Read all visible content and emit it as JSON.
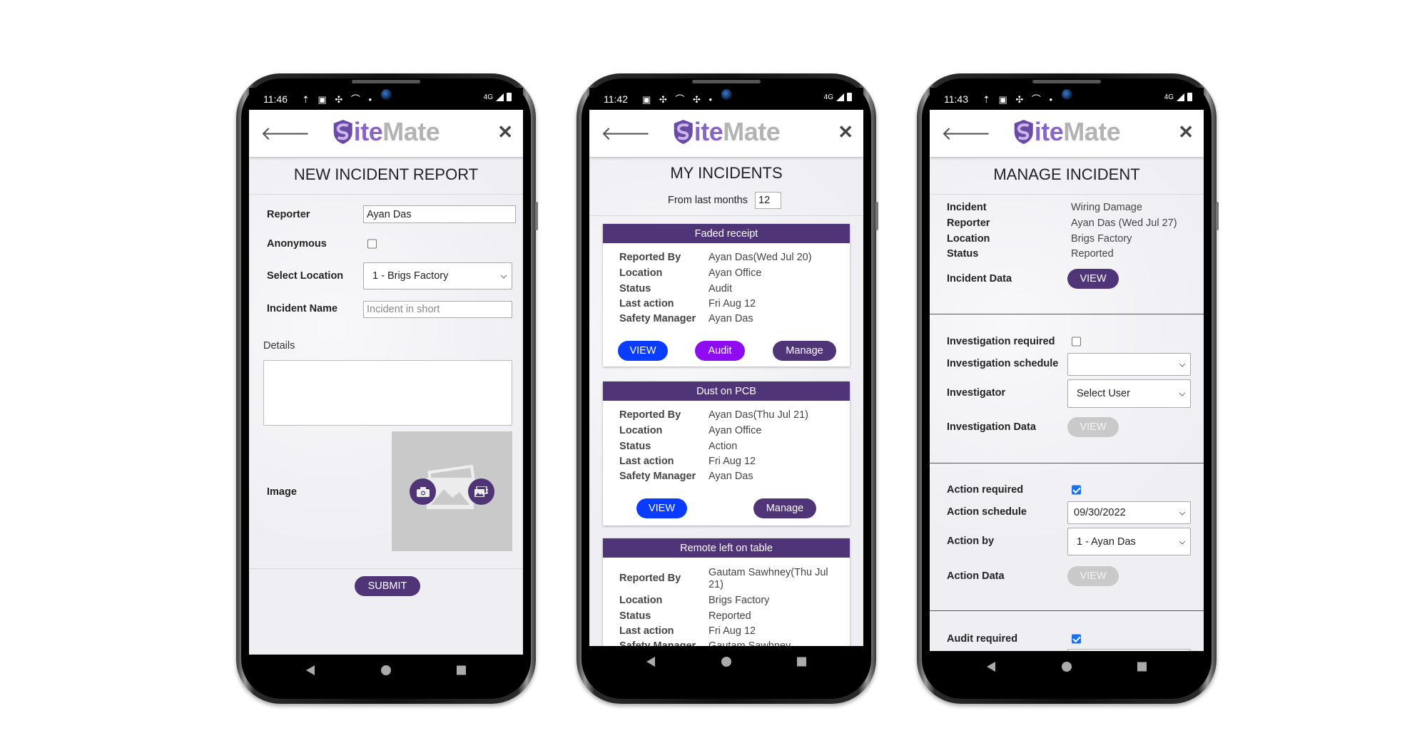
{
  "logo": {
    "a": "ite",
    "b": "Mate"
  },
  "colors": {
    "brand_purple": "#4f3478",
    "view_blue": "#0a3cff",
    "audit_violet": "#8f0cf0",
    "disabled": "#c9c9c9"
  },
  "phone1": {
    "status": {
      "time": "11:46",
      "network": "4G"
    },
    "title": "NEW INCIDENT REPORT",
    "reporter_label": "Reporter",
    "reporter_value": "Ayan Das",
    "anonymous_label": "Anonymous",
    "anonymous_checked": false,
    "location_label": "Select Location",
    "location_value": "1 - Brigs Factory",
    "incident_name_label": "Incident Name",
    "incident_name_placeholder": "Incident in short",
    "details_label": "Details",
    "image_label": "Image",
    "submit": "SUBMIT"
  },
  "phone2": {
    "status": {
      "time": "11:42",
      "network": "4G"
    },
    "title": "MY INCIDENTS",
    "months_label": "From last months",
    "months_value": "12",
    "field_labels": [
      "Reported By",
      "Location",
      "Status",
      "Last action",
      "Safety Manager"
    ],
    "cards": [
      {
        "title": "Faded receipt",
        "values": [
          "Ayan Das(Wed Jul 20)",
          "Ayan Office",
          "Audit",
          "Fri Aug 12",
          "Ayan Das"
        ],
        "buttons": [
          "VIEW",
          "Audit",
          "Manage"
        ]
      },
      {
        "title": "Dust on PCB",
        "values": [
          "Ayan Das(Thu Jul 21)",
          "Ayan Office",
          "Action",
          "Fri Aug 12",
          "Ayan Das"
        ],
        "buttons": [
          "VIEW",
          "Manage"
        ]
      },
      {
        "title": "Remote left on table",
        "values": [
          "Gautam Sawhney(Thu Jul 21)",
          "Brigs Factory",
          "Reported",
          "Fri Aug 12",
          "Gautam Sawhney"
        ]
      }
    ]
  },
  "phone3": {
    "status": {
      "time": "11:43",
      "network": "4G"
    },
    "title": "MANAGE INCIDENT",
    "info": [
      {
        "label": "Incident",
        "value": "Wiring Damage"
      },
      {
        "label": "Reporter",
        "value": "Ayan Das (Wed Jul 27)"
      },
      {
        "label": "Location",
        "value": "Brigs Factory"
      },
      {
        "label": "Status",
        "value": "Reported"
      }
    ],
    "incident_data_label": "Incident Data",
    "view": "VIEW",
    "investigation_required_label": "Investigation required",
    "investigation_required": false,
    "investigation_schedule_label": "Investigation schedule",
    "investigation_schedule_value": "",
    "investigator_label": "Investigator",
    "investigator_value": "Select User",
    "investigation_data_label": "Investigation Data",
    "action_required_label": "Action required",
    "action_required": true,
    "action_schedule_label": "Action schedule",
    "action_schedule_value": "09/30/2022",
    "action_by_label": "Action by",
    "action_by_value": "1 - Ayan Das",
    "action_data_label": "Action Data",
    "audit_required_label": "Audit required",
    "audit_required": true
  }
}
